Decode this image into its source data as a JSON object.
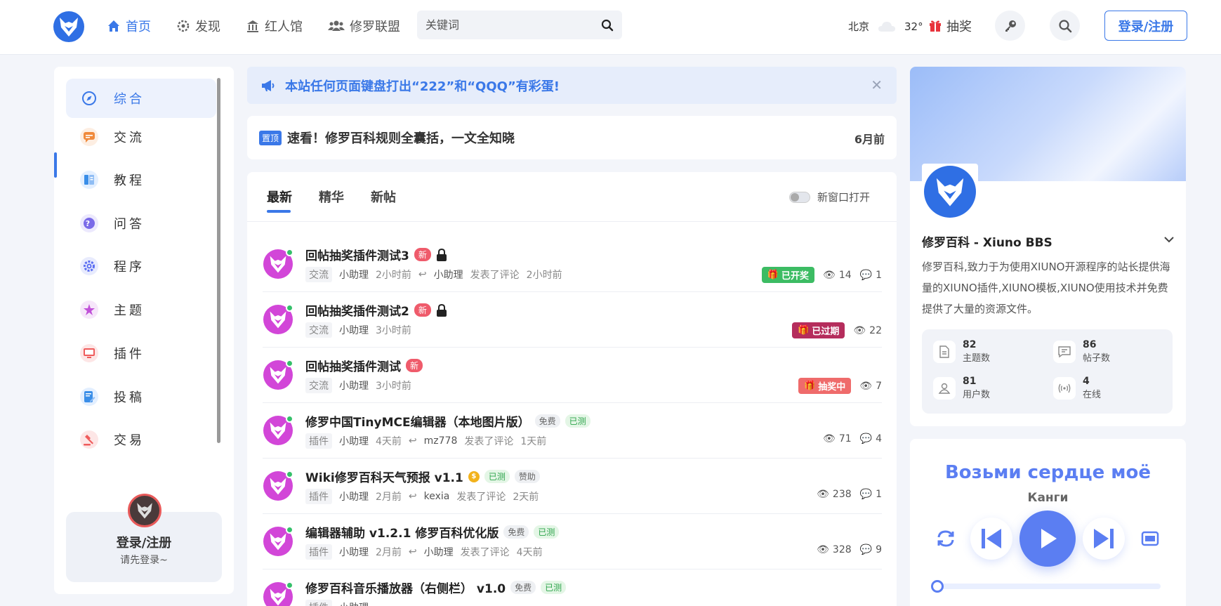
{
  "header": {
    "nav": [
      {
        "label": "首页",
        "icon": "home-icon",
        "active": true
      },
      {
        "label": "发现",
        "icon": "compass-gear-icon"
      },
      {
        "label": "红人馆",
        "icon": "building-icon"
      },
      {
        "label": "修罗联盟",
        "icon": "users-icon"
      }
    ],
    "search_placeholder": "关键词",
    "weather": {
      "city": "北京",
      "temp": "32°"
    },
    "prize_label": "抽奖",
    "login_label": "登录/注册"
  },
  "sidebar": {
    "items": [
      {
        "label": "综合",
        "icon": "compass-icon",
        "color": "#3a78e8"
      },
      {
        "label": "交流",
        "icon": "chat-icon",
        "color": "#f08a3c"
      },
      {
        "label": "教程",
        "icon": "book-icon",
        "color": "#3a8ee8"
      },
      {
        "label": "问答",
        "icon": "question-icon",
        "color": "#7a6ae8"
      },
      {
        "label": "程序",
        "icon": "gear-icon",
        "color": "#5b6ef2"
      },
      {
        "label": "主题",
        "icon": "star-icon",
        "color": "#c050d8"
      },
      {
        "label": "插件",
        "icon": "monitor-icon",
        "color": "#ef5b5b"
      },
      {
        "label": "投稿",
        "icon": "edit-icon",
        "color": "#3a8ee8"
      },
      {
        "label": "交易",
        "icon": "gavel-icon",
        "color": "#ef5b5b"
      }
    ],
    "login_title": "登录/注册",
    "login_sub": "请先登录~"
  },
  "notice": "本站任何页面键盘打出“222”和“QQQ”有彩蛋!",
  "pinned": {
    "tag": "置顶",
    "title": "速看！修罗百科规则全囊括，一文全知晓",
    "time": "6月前"
  },
  "tabs": [
    "最新",
    "精华",
    "新帖"
  ],
  "toggle_label": "新窗口打开",
  "threads": [
    {
      "title": "回帖抽奖插件测试3",
      "badges": [
        "新"
      ],
      "lock": true,
      "cat": "交流",
      "author": "小助理",
      "time": "2小时前",
      "reply_user": "小助理",
      "reply_text": "发表了评论",
      "reply_time": "2小时前",
      "status": "已开奖",
      "views": "14",
      "comments": "1"
    },
    {
      "title": "回帖抽奖插件测试2",
      "badges": [
        "新"
      ],
      "lock": true,
      "cat": "交流",
      "author": "小助理",
      "time": "3小时前",
      "status": "已过期",
      "views": "22"
    },
    {
      "title": "回帖抽奖插件测试",
      "badges": [
        "新"
      ],
      "cat": "交流",
      "author": "小助理",
      "time": "3小时前",
      "status": "抽奖中",
      "views": "7"
    },
    {
      "title": "修罗中国TinyMCE编辑器（本地图片版）",
      "badges": [
        "免费",
        "已测"
      ],
      "cat": "插件",
      "author": "小助理",
      "time": "4天前",
      "reply_user": "mz778",
      "reply_text": "发表了评论",
      "reply_time": "1天前",
      "views": "71",
      "comments": "4"
    },
    {
      "title": "Wiki修罗百科天气预报 v1.1",
      "coin": true,
      "badges": [
        "已测",
        "赞助"
      ],
      "cat": "插件",
      "author": "小助理",
      "time": "2月前",
      "reply_user": "kexia",
      "reply_text": "发表了评论",
      "reply_time": "2天前",
      "views": "238",
      "comments": "1"
    },
    {
      "title": "编辑器辅助 v1.2.1 修罗百科优化版",
      "badges": [
        "免费",
        "已测"
      ],
      "cat": "插件",
      "author": "小助理",
      "time": "2月前",
      "reply_user": "小助理",
      "reply_text": "发表了评论",
      "reply_time": "4天前",
      "views": "328",
      "comments": "9"
    },
    {
      "title": "修罗百科音乐播放器（右侧栏） v1.0",
      "badges": [
        "免费",
        "已测"
      ],
      "cat": "插件",
      "author": "小助理",
      "time": "",
      "views": "",
      "comments": ""
    }
  ],
  "profile": {
    "name": "修罗百科 - Xiuno BBS",
    "desc": "修罗百科,致力于为使用XIUNO开源程序的站长提供海量的XIUNO插件,XIUNO模板,XIUNO使用技术并免费提供了大量的资源文件。",
    "stats": [
      {
        "num": "82",
        "label": "主题数",
        "icon": "document-icon"
      },
      {
        "num": "86",
        "label": "帖子数",
        "icon": "message-icon"
      },
      {
        "num": "81",
        "label": "用户数",
        "icon": "user-group-icon"
      },
      {
        "num": "4",
        "label": "在线",
        "icon": "signal-icon"
      }
    ]
  },
  "music": {
    "song": "Возьми сердце моё",
    "artist": "Канги",
    "progress": 0.0
  }
}
